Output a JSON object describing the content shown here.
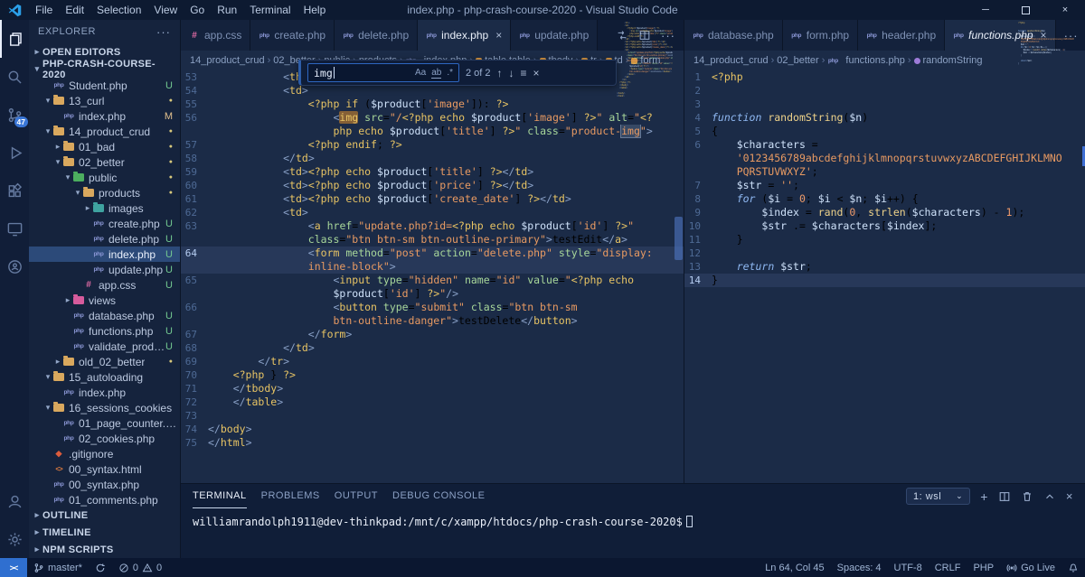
{
  "window": {
    "title": "index.php - php-crash-course-2020 - Visual Studio Code",
    "menus": [
      "File",
      "Edit",
      "Selection",
      "View",
      "Go",
      "Run",
      "Terminal",
      "Help"
    ]
  },
  "activity_bar": {
    "items": [
      {
        "name": "explorer",
        "active": true
      },
      {
        "name": "search"
      },
      {
        "name": "source-control",
        "badge": "47"
      },
      {
        "name": "run-debug"
      },
      {
        "name": "extensions"
      },
      {
        "name": "remote-explorer"
      },
      {
        "name": "live-share"
      }
    ],
    "bottom": [
      {
        "name": "accounts"
      },
      {
        "name": "settings"
      }
    ]
  },
  "sidebar": {
    "title": "EXPLORER",
    "open_editors_label": "OPEN EDITORS",
    "root_label": "PHP-CRASH-COURSE-2020",
    "bottom_sections": [
      "OUTLINE",
      "TIMELINE",
      "NPM SCRIPTS"
    ],
    "tree": [
      {
        "label": "Student.php",
        "type": "php",
        "depth": 1,
        "badge": "U"
      },
      {
        "label": "13_curl",
        "type": "folder",
        "depth": 1,
        "expanded": true,
        "dot": true
      },
      {
        "label": "index.php",
        "type": "php",
        "depth": 2,
        "badge": "M"
      },
      {
        "label": "14_product_crud",
        "type": "folder",
        "depth": 1,
        "expanded": true,
        "dot": true
      },
      {
        "label": "01_bad",
        "type": "folder",
        "depth": 2,
        "dot": true
      },
      {
        "label": "02_better",
        "type": "folder",
        "depth": 2,
        "expanded": true,
        "dot": true
      },
      {
        "label": "public",
        "type": "folder-public",
        "depth": 3,
        "expanded": true,
        "dot": true
      },
      {
        "label": "products",
        "type": "folder",
        "depth": 4,
        "expanded": true,
        "dot": true
      },
      {
        "label": "images",
        "type": "folder-images",
        "depth": 5
      },
      {
        "label": "create.php",
        "type": "php",
        "depth": 5,
        "badge": "U"
      },
      {
        "label": "delete.php",
        "type": "php",
        "depth": 5,
        "badge": "U"
      },
      {
        "label": "index.php",
        "type": "php",
        "depth": 5,
        "badge": "U",
        "selected": true
      },
      {
        "label": "update.php",
        "type": "php",
        "depth": 5,
        "badge": "U"
      },
      {
        "label": "app.css",
        "type": "css",
        "depth": 4,
        "badge": "U"
      },
      {
        "label": "views",
        "type": "folder-views",
        "depth": 3
      },
      {
        "label": "database.php",
        "type": "php",
        "depth": 3,
        "badge": "U"
      },
      {
        "label": "functions.php",
        "type": "php",
        "depth": 3,
        "badge": "U"
      },
      {
        "label": "validate_product...",
        "type": "php",
        "depth": 3,
        "badge": "U"
      },
      {
        "label": "old_02_better",
        "type": "folder",
        "depth": 2,
        "dot": true
      },
      {
        "label": "15_autoloading",
        "type": "folder",
        "depth": 1,
        "expanded": true
      },
      {
        "label": "index.php",
        "type": "php",
        "depth": 2
      },
      {
        "label": "16_sessions_cookies",
        "type": "folder",
        "depth": 1,
        "expanded": true
      },
      {
        "label": "01_page_counter.php",
        "type": "php",
        "depth": 2
      },
      {
        "label": "02_cookies.php",
        "type": "php",
        "depth": 2
      },
      {
        "label": ".gitignore",
        "type": "git",
        "depth": 1
      },
      {
        "label": "00_syntax.html",
        "type": "html",
        "depth": 1
      },
      {
        "label": "00_syntax.php",
        "type": "php",
        "depth": 1
      },
      {
        "label": "01_comments.php",
        "type": "php",
        "depth": 1
      }
    ]
  },
  "groups": [
    {
      "tabs": [
        {
          "label": "app.css",
          "type": "css"
        },
        {
          "label": "create.php",
          "type": "php"
        },
        {
          "label": "delete.php",
          "type": "php"
        },
        {
          "label": "index.php",
          "type": "php",
          "active": true
        },
        {
          "label": "update.php",
          "type": "php"
        }
      ],
      "breadcrumbs": [
        {
          "label": "14_product_crud"
        },
        {
          "label": "02_better"
        },
        {
          "label": "public"
        },
        {
          "label": "products"
        },
        {
          "label": "index.php",
          "icon": "php"
        },
        {
          "label": "table.table",
          "icon": "sym"
        },
        {
          "label": "tbody",
          "icon": "sym"
        },
        {
          "label": "tr",
          "icon": "sym"
        },
        {
          "label": "td",
          "icon": "sym"
        },
        {
          "label": "form",
          "icon": "sym"
        }
      ],
      "lines": [
        {
          "n": 53,
          "t": "            <th s"
        },
        {
          "n": 54,
          "t": "            <td>"
        },
        {
          "n": 55,
          "t": "                <?php if ($product['image']): ?>"
        },
        {
          "n": 56,
          "t": "                    <img src=\"/<?php echo $product['image'] ?>\" alt=\"<?",
          "find": "current"
        },
        {
          "n": null,
          "t": "                    php echo $product['title'] ?>\" class=\"product-img\">",
          "find": "other"
        },
        {
          "n": 57,
          "t": "                <?php endif; ?>"
        },
        {
          "n": 58,
          "t": "            </td>"
        },
        {
          "n": 59,
          "t": "            <td><?php echo $product['title'] ?></td>"
        },
        {
          "n": 60,
          "t": "            <td><?php echo $product['price'] ?></td>"
        },
        {
          "n": 61,
          "t": "            <td><?php echo $product['create_date'] ?></td>"
        },
        {
          "n": 62,
          "t": "            <td>"
        },
        {
          "n": 63,
          "t": "                <a href=\"update.php?id=<?php echo $product['id'] ?>\""
        },
        {
          "n": null,
          "t": "                class=\"btn btn-sm btn-outline-primary\">testEdit</a>"
        },
        {
          "n": 64,
          "t": "                <form method=\"post\" action=\"delete.php\" style=\"display:",
          "cur": true
        },
        {
          "n": null,
          "t": "                inline-block\">",
          "cur": true
        },
        {
          "n": 65,
          "t": "                    <input type=\"hidden\" name=\"id\" value=\"<?php echo"
        },
        {
          "n": null,
          "t": "                    $product['id'] ?>\"/>"
        },
        {
          "n": 66,
          "t": "                    <button type=\"submit\" class=\"btn btn-sm"
        },
        {
          "n": null,
          "t": "                    btn-outline-danger\">testDelete</button>"
        },
        {
          "n": 67,
          "t": "                </form>"
        },
        {
          "n": 68,
          "t": "            </td>"
        },
        {
          "n": 69,
          "t": "        </tr>"
        },
        {
          "n": 70,
          "t": "    <?php } ?>"
        },
        {
          "n": 71,
          "t": "    </tbody>"
        },
        {
          "n": 72,
          "t": "    </table>"
        },
        {
          "n": 73,
          "t": ""
        },
        {
          "n": 74,
          "t": "</body>"
        },
        {
          "n": 75,
          "t": "</html>"
        }
      ]
    },
    {
      "tabs": [
        {
          "label": "database.php",
          "type": "php"
        },
        {
          "label": "form.php",
          "type": "php"
        },
        {
          "label": "header.php",
          "type": "php"
        },
        {
          "label": "functions.php",
          "type": "php",
          "active": true,
          "preview": true
        }
      ],
      "breadcrumbs": [
        {
          "label": "14_product_crud"
        },
        {
          "label": "02_better"
        },
        {
          "label": "functions.php",
          "icon": "php"
        },
        {
          "label": "randomString",
          "icon": "method"
        }
      ],
      "lines": [
        {
          "n": 1,
          "t": "<?php"
        },
        {
          "n": 2,
          "t": ""
        },
        {
          "n": 3,
          "t": ""
        },
        {
          "n": 4,
          "t": "function randomString($n)"
        },
        {
          "n": 5,
          "t": "{"
        },
        {
          "n": 6,
          "t": "    $characters ="
        },
        {
          "n": null,
          "t": "    '0123456789abcdefghijklmnopqrstuvwxyzABCDEFGHIJKLMNO"
        },
        {
          "n": null,
          "t": "    PQRSTUVWXYZ';"
        },
        {
          "n": 7,
          "t": "    $str = '';"
        },
        {
          "n": 8,
          "t": "    for ($i = 0; $i < $n; $i++) {"
        },
        {
          "n": 9,
          "t": "        $index = rand(0, strlen($characters) - 1);"
        },
        {
          "n": 10,
          "t": "        $str .= $characters[$index];"
        },
        {
          "n": 11,
          "t": "    }"
        },
        {
          "n": 12,
          "t": ""
        },
        {
          "n": 13,
          "t": "    return $str;"
        },
        {
          "n": 14,
          "t": "}",
          "cur": true
        }
      ]
    }
  ],
  "find": {
    "query": "img",
    "results": "2 of 2",
    "toggles": [
      "Aa",
      "ab",
      ".*"
    ]
  },
  "panel": {
    "tabs": [
      "TERMINAL",
      "PROBLEMS",
      "OUTPUT",
      "DEBUG CONSOLE"
    ],
    "active_tab": "TERMINAL",
    "shell": "1: wsl",
    "prompt": "williamrandolph1911@dev-thinkpad:/mnt/c/xampp/htdocs/php-crash-course-2020$"
  },
  "status": {
    "branch": "master*",
    "errors": "0",
    "warnings": "0",
    "ln_col": "Ln 64, Col 45",
    "indent": "Spaces: 4",
    "encoding": "UTF-8",
    "eol": "CRLF",
    "lang": "PHP",
    "go_live": "Go Live"
  },
  "colors": {
    "accent_blue": "#2f6fd0",
    "untracked_green": "#73c991",
    "modified_orange": "#e2c08d",
    "badge_blue": "#3a76d6"
  }
}
